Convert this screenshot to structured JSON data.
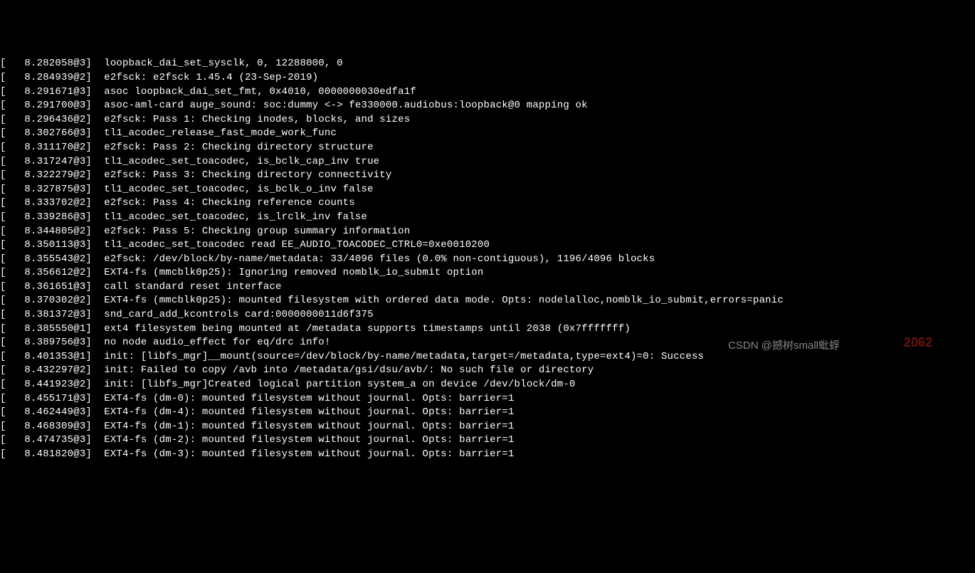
{
  "terminal": {
    "lines": [
      {
        "ts": "8.282058@3",
        "msg": "loopback_dai_set_sysclk, 0, 12288000, 0"
      },
      {
        "ts": "8.284939@2",
        "msg": "e2fsck: e2fsck 1.45.4 (23-Sep-2019)"
      },
      {
        "ts": "8.291671@3",
        "msg": "asoc loopback_dai_set_fmt, 0x4010, 0000000030edfa1f"
      },
      {
        "ts": "8.291700@3",
        "msg": "asoc-aml-card auge_sound: soc:dummy <-> fe330000.audiobus:loopback@0 mapping ok"
      },
      {
        "ts": "8.296436@2",
        "msg": "e2fsck: Pass 1: Checking inodes, blocks, and sizes"
      },
      {
        "ts": "8.302766@3",
        "msg": "tl1_acodec_release_fast_mode_work_func"
      },
      {
        "ts": "8.311170@2",
        "msg": "e2fsck: Pass 2: Checking directory structure"
      },
      {
        "ts": "8.317247@3",
        "msg": "tl1_acodec_set_toacodec, is_bclk_cap_inv true"
      },
      {
        "ts": "8.322279@2",
        "msg": "e2fsck: Pass 3: Checking directory connectivity"
      },
      {
        "ts": "8.327875@3",
        "msg": "tl1_acodec_set_toacodec, is_bclk_o_inv false"
      },
      {
        "ts": "8.333702@2",
        "msg": "e2fsck: Pass 4: Checking reference counts"
      },
      {
        "ts": "8.339286@3",
        "msg": "tl1_acodec_set_toacodec, is_lrclk_inv false"
      },
      {
        "ts": "8.344805@2",
        "msg": "e2fsck: Pass 5: Checking group summary information"
      },
      {
        "ts": "8.350113@3",
        "msg": "tl1_acodec_set_toacodec read EE_AUDIO_TOACODEC_CTRL0=0xe0010200"
      },
      {
        "ts": "8.355543@2",
        "msg": "e2fsck: /dev/block/by-name/metadata: 33/4096 files (0.0% non-contiguous), 1196/4096 blocks"
      },
      {
        "ts": "8.356612@2",
        "msg": "EXT4-fs (mmcblk0p25): Ignoring removed nomblk_io_submit option"
      },
      {
        "ts": "8.361651@3",
        "msg": "call standard reset interface"
      },
      {
        "ts": "8.370302@2",
        "msg": "EXT4-fs (mmcblk0p25): mounted filesystem with ordered data mode. Opts: nodelalloc,nomblk_io_submit,errors=panic"
      },
      {
        "ts": "8.381372@3",
        "msg": "snd_card_add_kcontrols card:0000000011d6f375"
      },
      {
        "ts": "8.385550@1",
        "msg": "ext4 filesystem being mounted at /metadata supports timestamps until 2038 (0x7fffffff)"
      },
      {
        "ts": "8.389756@3",
        "msg": "no node audio_effect for eq/drc info!"
      },
      {
        "ts": "8.401353@1",
        "msg": "init: [libfs_mgr]__mount(source=/dev/block/by-name/metadata,target=/metadata,type=ext4)=0: Success"
      },
      {
        "ts": "8.432297@2",
        "msg": "init: Failed to copy /avb into /metadata/gsi/dsu/avb/: No such file or directory"
      },
      {
        "ts": "8.441923@2",
        "msg": "init: [libfs_mgr]Created logical partition system_a on device /dev/block/dm-0"
      },
      {
        "ts": "8.455171@3",
        "msg": "EXT4-fs (dm-0): mounted filesystem without journal. Opts: barrier=1"
      },
      {
        "ts": "8.462449@3",
        "msg": "EXT4-fs (dm-4): mounted filesystem without journal. Opts: barrier=1"
      },
      {
        "ts": "8.468309@3",
        "msg": "EXT4-fs (dm-1): mounted filesystem without journal. Opts: barrier=1"
      },
      {
        "ts": "8.474735@3",
        "msg": "EXT4-fs (dm-2): mounted filesystem without journal. Opts: barrier=1"
      },
      {
        "ts": "8.481820@3",
        "msg": "EXT4-fs (dm-3): mounted filesystem without journal. Opts: barrier=1"
      }
    ]
  },
  "watermark": {
    "csdn": "CSDN @撼树small蚍蜉",
    "red": "2062"
  }
}
